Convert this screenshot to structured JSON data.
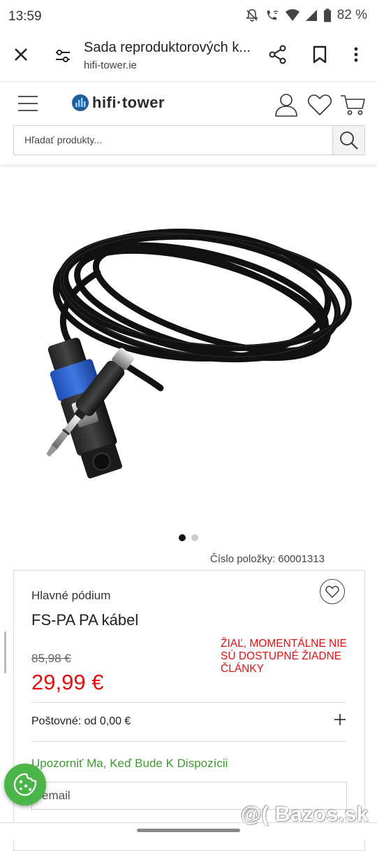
{
  "status_bar": {
    "time": "13:59",
    "battery": "82 %",
    "icons": [
      "mute-bell-icon",
      "wifi-call-icon",
      "wifi-icon",
      "signal-icon",
      "battery-icon"
    ]
  },
  "browser": {
    "page_title": "Sada reproduktorových k...",
    "url": "hifi-tower.ie",
    "icons": [
      "close-icon",
      "tune-icon",
      "share-icon",
      "bookmark-icon",
      "more-vert-icon"
    ]
  },
  "site": {
    "logo_text": "hifi·tower",
    "search_placeholder": "Hľadať produkty...",
    "icons": [
      "menu-icon",
      "user-icon",
      "heart-icon",
      "cart-icon",
      "search-icon"
    ]
  },
  "gallery": {
    "slides": 2,
    "active_slide": 1
  },
  "product": {
    "item_number_label": "Číslo položky:",
    "item_number": "60001313",
    "brand": "Hlavné pódium",
    "name": "FS-PA PA kábel",
    "old_price": "85,98 €",
    "price": "29,99 €",
    "stock_notice": "ŽIAĽ, MOMENTÁLNE NIE SÚ DOSTUPNÉ ŽIADNE ČLÁNKY",
    "shipping": "Poštovné: od 0,00 €",
    "notify_label": "Upozorniť Ma, Keď Bude K Dispozícii",
    "email_placeholder": "email"
  },
  "watermark": "@( Bazos.sk",
  "colors": {
    "price_red": "#e10f0f",
    "notify_green": "#3c9a2e",
    "cookie_green": "#4bb54a"
  }
}
